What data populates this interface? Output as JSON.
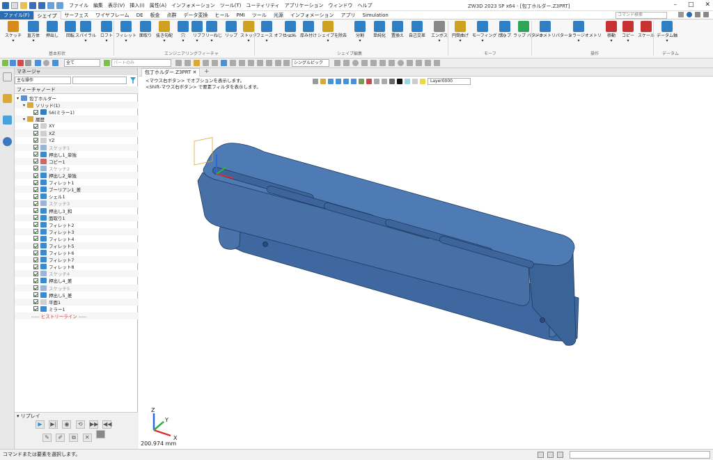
{
  "app": {
    "title": "ZW3D 2023 SP x64 - [包丁ホルダー.Z3PRT]",
    "menus": [
      "ファイル",
      "編集",
      "表示(V)",
      "挿入(I)",
      "属性(A)",
      "インフォメーション",
      "ツール(T)",
      "ユーティリティ",
      "アプリケーション",
      "ウィンドウ",
      "ヘルプ"
    ],
    "window_buttons": [
      "–",
      "□",
      "✕"
    ]
  },
  "ribbon_tabs": [
    "ファイル(F)",
    "シェイプ",
    "サーフェス",
    "ワイヤフレーム",
    "DE",
    "板金",
    "点群",
    "データ変換",
    "ヒール",
    "PMI",
    "ツール",
    "光源",
    "インフォメーション",
    "アプリ",
    "Simulation"
  ],
  "active_tab": "シェイプ",
  "command_search": {
    "placeholder": "コマンド検索"
  },
  "ribbon": {
    "buttons": [
      {
        "label": "スケッチ",
        "color": "#d88a1a",
        "sub": "▾"
      },
      {
        "label": "直方体",
        "color": "#2e7fc4",
        "sub": "▾"
      },
      {
        "label": "押出し",
        "color": "#2e7fc4",
        "sub": ""
      },
      {
        "label": "回転",
        "color": "#2e7fc4",
        "sub": ""
      },
      {
        "label": "スパイラル",
        "color": "#2e7fc4",
        "sub": "▾"
      },
      {
        "label": "ロフト",
        "color": "#2e7fc4",
        "sub": "▾"
      },
      {
        "label": "フィレット",
        "color": "#2e7fc4",
        "sub": "▾"
      },
      {
        "label": "面取り",
        "color": "#2e7fc4",
        "sub": ""
      },
      {
        "label": "抜き勾配",
        "color": "#d0a020",
        "sub": "▾"
      },
      {
        "label": "穴",
        "color": "#2e7fc4",
        "sub": "▾"
      },
      {
        "label": "リブ",
        "color": "#2e7fc4",
        "sub": "▾"
      },
      {
        "label": "フリーねじ",
        "color": "#2e7fc4",
        "sub": "▾"
      },
      {
        "label": "リップ",
        "color": "#2e7fc4",
        "sub": ""
      },
      {
        "label": "ストック",
        "color": "#d0a020",
        "sub": "▾"
      },
      {
        "label": "フェース オフセット",
        "color": "#2e7fc4",
        "sub": "▾"
      },
      {
        "label": "シェル",
        "color": "#2e7fc4",
        "sub": ""
      },
      {
        "label": "厚み付け",
        "color": "#2e7fc4",
        "sub": ""
      },
      {
        "label": "シェイプを除去",
        "color": "#d0a020",
        "sub": "▾"
      },
      {
        "label": "分割",
        "color": "#2e7fc4",
        "sub": "▾"
      },
      {
        "label": "単純化",
        "color": "#2e7fc4",
        "sub": ""
      },
      {
        "label": "置換え",
        "color": "#2e7fc4",
        "sub": ""
      },
      {
        "label": "自己交差",
        "color": "#2e7fc4",
        "sub": ""
      },
      {
        "label": "エンボス",
        "color": "#888888",
        "sub": "▾"
      },
      {
        "label": "円筒曲げ",
        "color": "#d0a020",
        "sub": "▾"
      },
      {
        "label": "モーフィング (点)",
        "color": "#2e7fc4",
        "sub": "▾"
      },
      {
        "label": "ラップ",
        "color": "#2e7fc4",
        "sub": ""
      },
      {
        "label": "ラップ パターン",
        "color": "#2ea35a",
        "sub": ""
      },
      {
        "label": "ジオメトリパターン",
        "color": "#2e7fc4",
        "sub": ""
      },
      {
        "label": "ミラージオメトリ",
        "color": "#2e7fc4",
        "sub": "▾"
      },
      {
        "label": "移動",
        "color": "#c83232",
        "sub": "▾"
      },
      {
        "label": "コピー",
        "color": "#c83232",
        "sub": "▾"
      },
      {
        "label": "スケール",
        "color": "#c83232",
        "sub": ""
      },
      {
        "label": "データム軸",
        "color": "#2e7fc4",
        "sub": "▾"
      }
    ],
    "groups": [
      "基本形状",
      "エンジニアリングフィーチャ",
      "シェイプ編集",
      "モーフ",
      "操作",
      "データム"
    ]
  },
  "toolbar": {
    "filter_value": "全て",
    "part_placeholder": "パートのみ",
    "pick_mode": "シングルピック"
  },
  "manager": {
    "title": "マネージャ",
    "mode": "主な操作",
    "column_header": "フィーチャノード",
    "tree": [
      {
        "indent": 0,
        "label": "包丁ホルダー",
        "icon": "#5a8fd0",
        "check": false,
        "disabled": false,
        "expander": "▾"
      },
      {
        "indent": 1,
        "label": "ソリッド(1)",
        "icon": "#d8a83a",
        "check": false,
        "disabled": false,
        "expander": "▾"
      },
      {
        "indent": 2,
        "label": "S6(ミラー1)",
        "icon": "#2e7fc4",
        "check": true,
        "disabled": false,
        "expander": ""
      },
      {
        "indent": 1,
        "label": "履歴",
        "icon": "#d8a83a",
        "check": false,
        "disabled": false,
        "expander": "▾"
      },
      {
        "indent": 2,
        "label": "XY",
        "icon": "#cfcfcf",
        "check": true,
        "disabled": false,
        "expander": ""
      },
      {
        "indent": 2,
        "label": "XZ",
        "icon": "#cfcfcf",
        "check": true,
        "disabled": false,
        "expander": ""
      },
      {
        "indent": 2,
        "label": "YZ",
        "icon": "#cfcfcf",
        "check": true,
        "disabled": false,
        "expander": ""
      },
      {
        "indent": 2,
        "label": "スケッチ1",
        "icon": "#9bb5d6",
        "check": true,
        "disabled": true,
        "expander": ""
      },
      {
        "indent": 2,
        "label": "押出し1_単独",
        "icon": "#3a8ad0",
        "check": true,
        "disabled": false,
        "expander": ""
      },
      {
        "indent": 2,
        "label": "コピー1",
        "icon": "#c86a6a",
        "check": true,
        "disabled": false,
        "expander": ""
      },
      {
        "indent": 2,
        "label": "スケッチ2",
        "icon": "#9bb5d6",
        "check": true,
        "disabled": true,
        "expander": ""
      },
      {
        "indent": 2,
        "label": "押出し2_単独",
        "icon": "#3a8ad0",
        "check": true,
        "disabled": false,
        "expander": ""
      },
      {
        "indent": 2,
        "label": "フィレット1",
        "icon": "#3a8ad0",
        "check": true,
        "disabled": false,
        "expander": ""
      },
      {
        "indent": 2,
        "label": "ブーリアン1_差",
        "icon": "#3a8ad0",
        "check": true,
        "disabled": false,
        "expander": ""
      },
      {
        "indent": 2,
        "label": "シェル1",
        "icon": "#3a8ad0",
        "check": true,
        "disabled": false,
        "expander": ""
      },
      {
        "indent": 2,
        "label": "スケッチ3",
        "icon": "#9bb5d6",
        "check": true,
        "disabled": true,
        "expander": ""
      },
      {
        "indent": 2,
        "label": "押出し3_和",
        "icon": "#3a8ad0",
        "check": true,
        "disabled": false,
        "expander": ""
      },
      {
        "indent": 2,
        "label": "面取り1",
        "icon": "#3a8ad0",
        "check": true,
        "disabled": false,
        "expander": ""
      },
      {
        "indent": 2,
        "label": "フィレット2",
        "icon": "#3a8ad0",
        "check": true,
        "disabled": false,
        "expander": ""
      },
      {
        "indent": 2,
        "label": "フィレット3",
        "icon": "#3a8ad0",
        "check": true,
        "disabled": false,
        "expander": ""
      },
      {
        "indent": 2,
        "label": "フィレット4",
        "icon": "#3a8ad0",
        "check": true,
        "disabled": false,
        "expander": ""
      },
      {
        "indent": 2,
        "label": "フィレット5",
        "icon": "#3a8ad0",
        "check": true,
        "disabled": false,
        "expander": ""
      },
      {
        "indent": 2,
        "label": "フィレット6",
        "icon": "#3a8ad0",
        "check": true,
        "disabled": false,
        "expander": ""
      },
      {
        "indent": 2,
        "label": "フィレット7",
        "icon": "#3a8ad0",
        "check": true,
        "disabled": false,
        "expander": ""
      },
      {
        "indent": 2,
        "label": "フィレット8",
        "icon": "#3a8ad0",
        "check": true,
        "disabled": false,
        "expander": ""
      },
      {
        "indent": 2,
        "label": "スケッチ4",
        "icon": "#9bb5d6",
        "check": true,
        "disabled": true,
        "expander": ""
      },
      {
        "indent": 2,
        "label": "押出し4_差",
        "icon": "#3a8ad0",
        "check": true,
        "disabled": false,
        "expander": ""
      },
      {
        "indent": 2,
        "label": "スケッチ5",
        "icon": "#9bb5d6",
        "check": true,
        "disabled": true,
        "expander": ""
      },
      {
        "indent": 2,
        "label": "押出し5_差",
        "icon": "#3a8ad0",
        "check": true,
        "disabled": false,
        "expander": ""
      },
      {
        "indent": 2,
        "label": "平面1",
        "icon": "#cfcfcf",
        "check": true,
        "disabled": false,
        "expander": ""
      },
      {
        "indent": 2,
        "label": "ミラー1",
        "icon": "#3a8ad0",
        "check": true,
        "disabled": false,
        "expander": ""
      }
    ],
    "rollback_label": "----- ヒストリーライン -----",
    "replay_title": "リプレイ"
  },
  "viewport": {
    "doc_tab": "包丁ホルダー.Z3PRT",
    "hint_line1": "<マウス右ボタン> でオプションを表示します。",
    "hint_line2": "<Shift-マウス右ボタン> で要素フィルタを表示します。",
    "layer": "Layer0000",
    "scale_readout": "200.974 mm",
    "model_color": "#4c76ad",
    "triad": {
      "x": "X",
      "y": "Y",
      "z": "Z"
    }
  },
  "status": {
    "message": "コマンドまたは要素を選択します。"
  }
}
